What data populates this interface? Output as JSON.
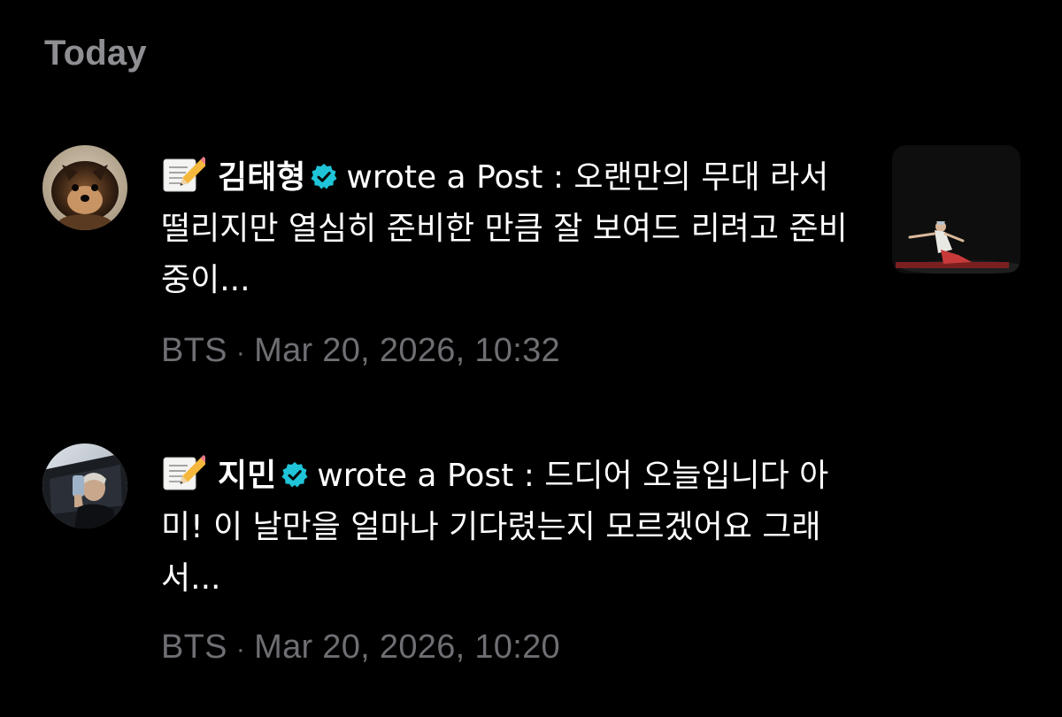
{
  "section": {
    "title": "Today"
  },
  "notifications": [
    {
      "author": "김태형",
      "action": "wrote a Post : ",
      "text": "오랜만의 무대 라서 떨리지만 열심히 준비한 만큼 잘 보여드 리려고 준비 중이...",
      "source": "BTS",
      "separator": "·",
      "timestamp": "Mar 20, 2026, 10:32",
      "avatar_icon": "pomeranian-dog-avatar",
      "has_thumbnail": true
    },
    {
      "author": "지민",
      "action": "wrote a Post : ",
      "text": "드디어 오늘입니다 아미! 이 날만을 얼마나 기다렸는지 모르겠어요 그래서...",
      "source": "BTS",
      "separator": "·",
      "timestamp": "Mar 20, 2026, 10:20",
      "avatar_icon": "selfie-person-avatar",
      "has_thumbnail": false
    }
  ],
  "colors": {
    "background": "#000000",
    "header_text": "#8e8e93",
    "body_text": "#ffffff",
    "meta_text": "#6e6e73",
    "verified": "#1fc4d8"
  },
  "icons": {
    "memo": "memo-icon",
    "verified": "verified-badge-icon"
  }
}
